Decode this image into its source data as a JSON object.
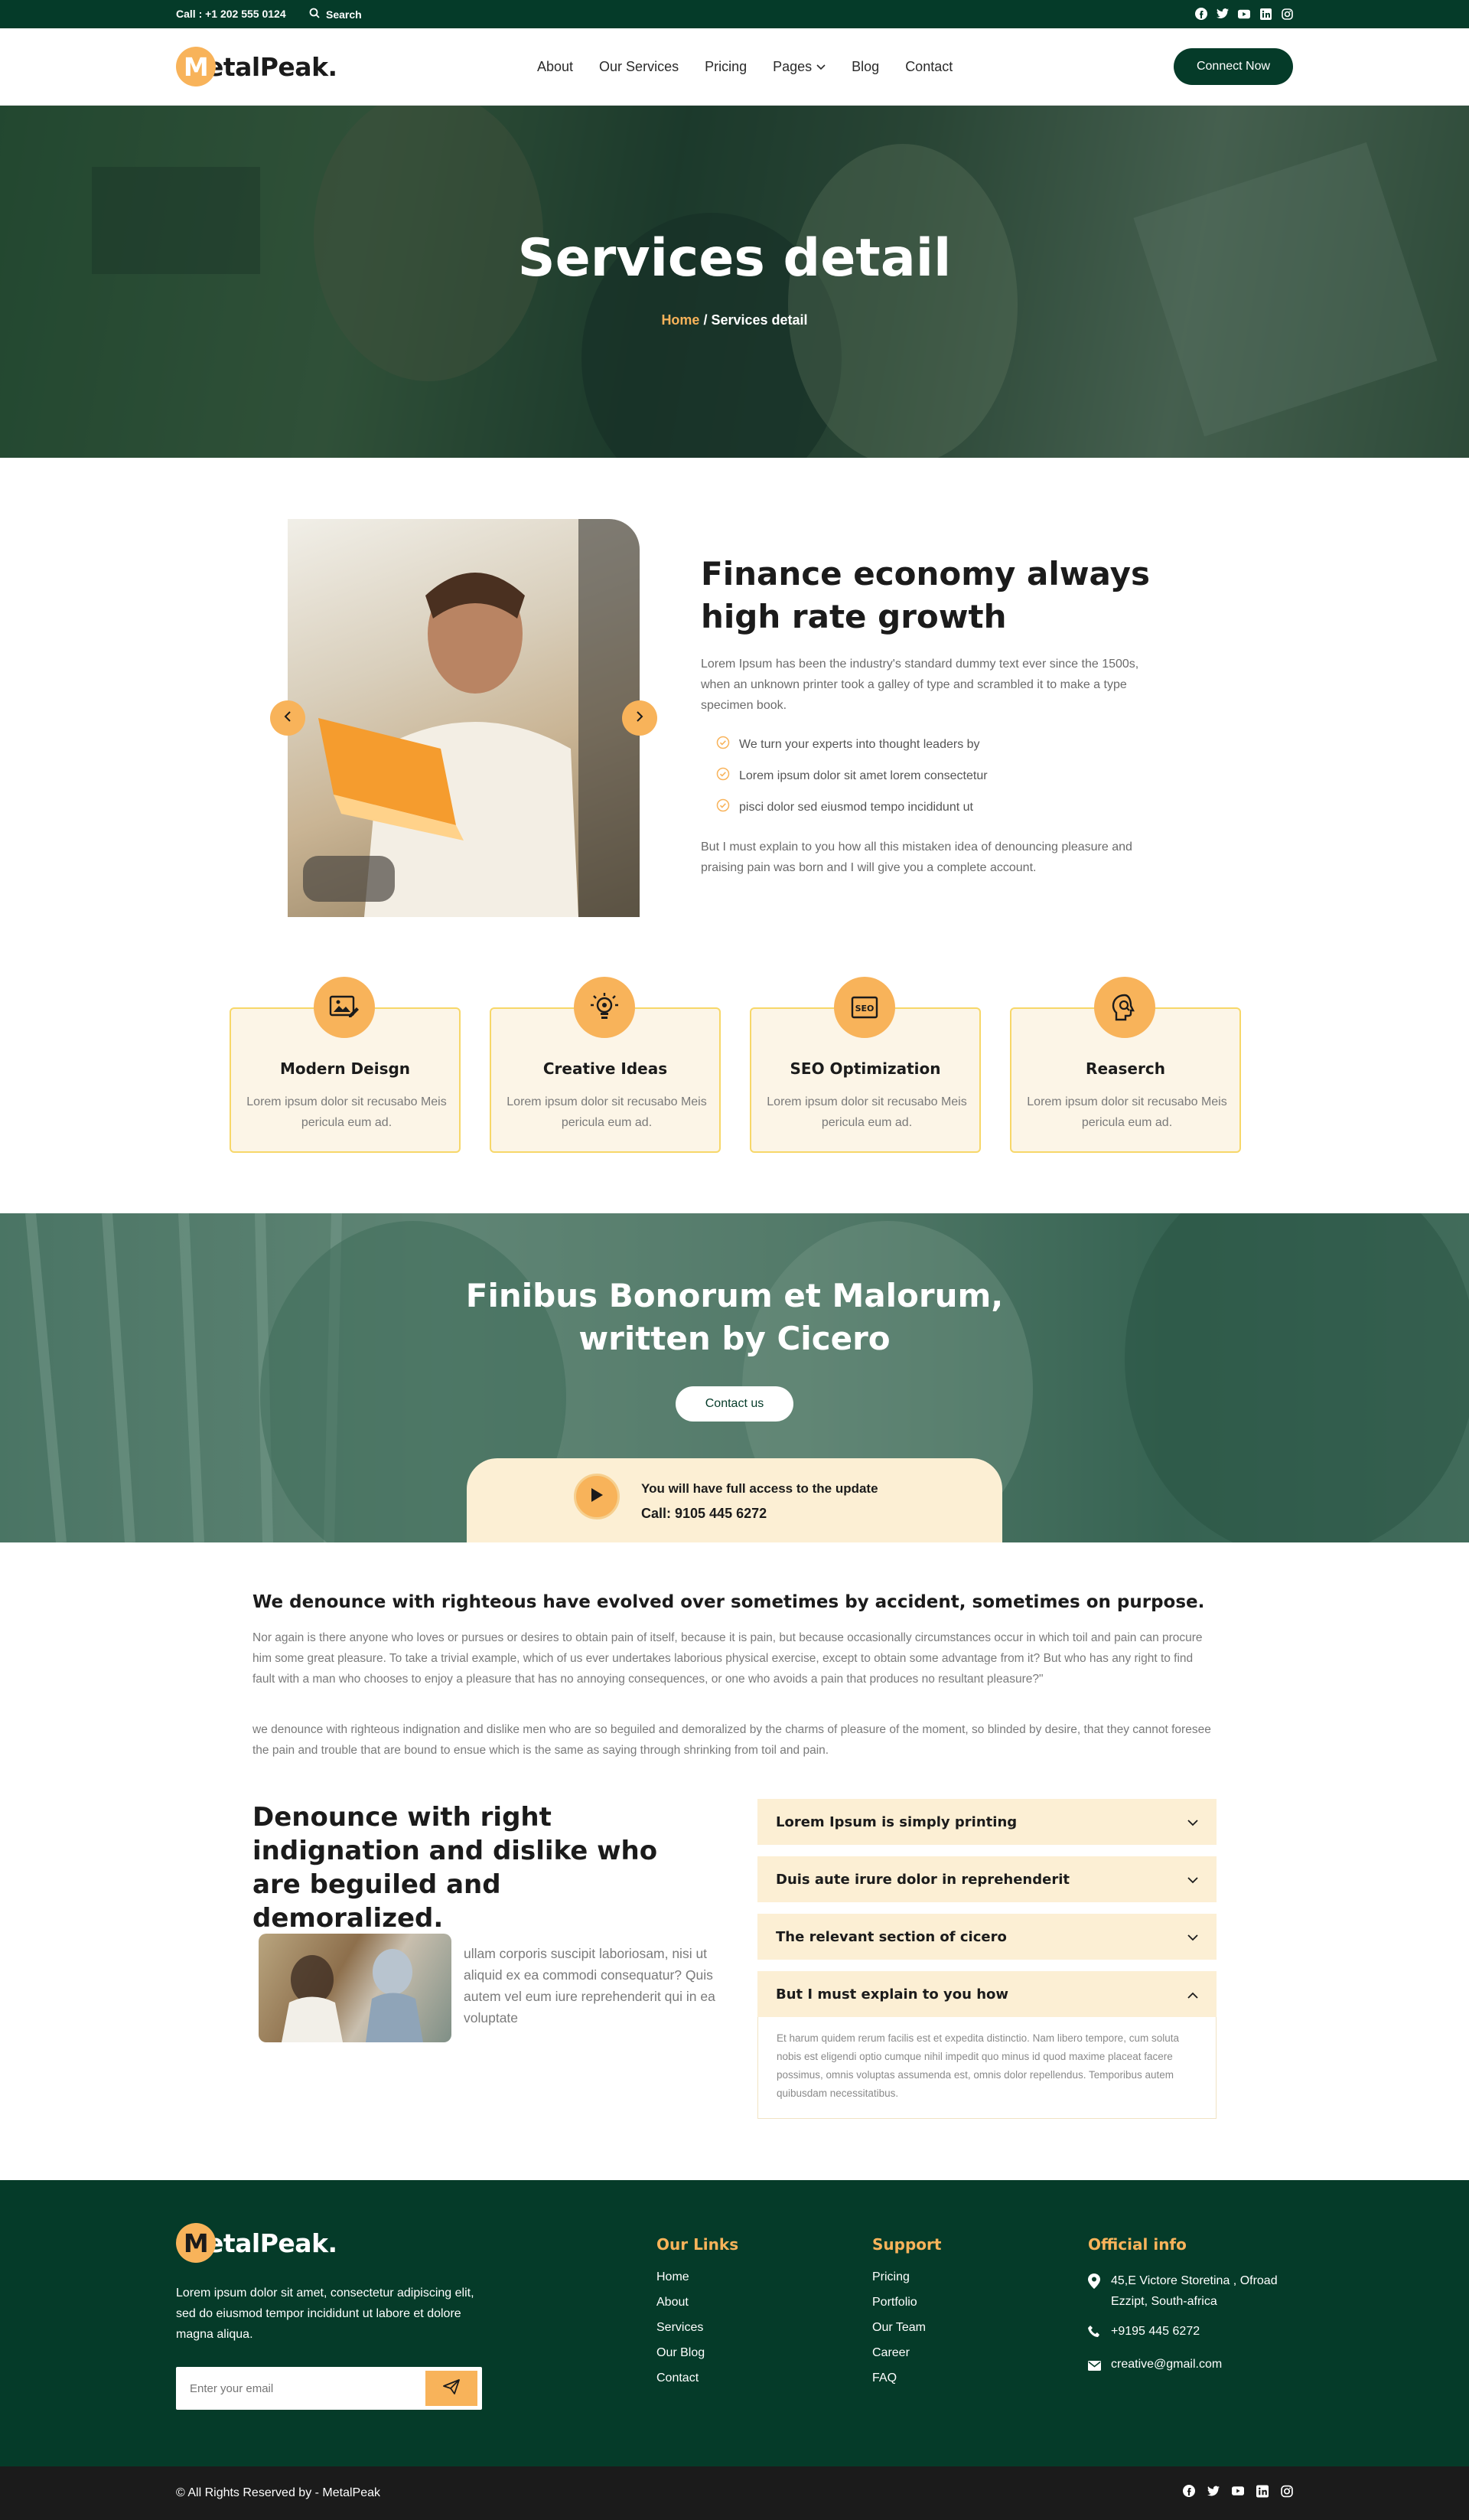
{
  "topbar": {
    "call": "Call : +1 202 555 0124",
    "search": "Search",
    "social_icons": [
      "facebook-icon",
      "twitter-icon",
      "youtube-icon",
      "linkedin-icon",
      "instagram-icon"
    ]
  },
  "brand": {
    "logo_letter": "M",
    "logo_rest": "etalPeak.",
    "accent": "#f8b35a",
    "primary": "#053b29"
  },
  "nav": {
    "items": [
      "About",
      "Our Services",
      "Pricing",
      "Pages",
      "Blog",
      "Contact"
    ],
    "cta": "Connect Now"
  },
  "hero": {
    "title": "Services detail",
    "crumb_home": "Home",
    "crumb_sep": " / ",
    "crumb_current": "Services detail"
  },
  "intro": {
    "heading": "Finance economy always high rate growth",
    "paragraph": "Lorem Ipsum has been the industry's standard dummy text ever since the 1500s, when an unknown printer took a galley of type and scrambled it to make a type specimen book.",
    "list": [
      "We turn your experts into thought leaders by",
      "Lorem ipsum dolor sit amet lorem consectetur",
      "pisci dolor sed eiusmod tempo incididunt ut"
    ],
    "paragraph2": "But I must explain to you how all this mistaken idea of denouncing pleasure and praising pain was born and I will give you a complete account."
  },
  "features": [
    {
      "title": "Modern Deisgn",
      "text": "Lorem ipsum dolor sit recusabo Meis pericula eum ad.",
      "icon": "image-edit-icon"
    },
    {
      "title": "Creative Ideas",
      "text": "Lorem ipsum dolor sit recusabo Meis pericula eum ad.",
      "icon": "bulb-icon"
    },
    {
      "title": "SEO Optimization",
      "text": "Lorem ipsum dolor sit recusabo Meis pericula eum ad.",
      "icon": "seo-icon"
    },
    {
      "title": "Reaserch",
      "text": "Lorem ipsum dolor sit recusabo Meis pericula eum ad.",
      "icon": "brain-search-icon"
    }
  ],
  "banner": {
    "line1": "Finibus Bonorum et Malorum,",
    "line2": "written by Cicero",
    "button": "Contact us",
    "strip_text": "You will have full access to the update",
    "strip_phone": "Call: 9105 445 6272"
  },
  "article": {
    "heading": "We denounce with righteous have evolved over sometimes by accident, sometimes on purpose.",
    "p1": "Nor again is there anyone who loves or pursues or desires to obtain pain of itself, because it is pain, but because occasionally circumstances occur in which toil and pain can procure him some great pleasure. To take a trivial example, which of us ever undertakes laborious physical exercise, except to obtain some advantage from it? But who has any right to find fault with a man who chooses to enjoy a pleasure that has no annoying consequences, or one who avoids a pain that produces no resultant pleasure?\"",
    "p2": "we denounce with righteous indignation and dislike men who are so beguiled and demoralized by the charms of pleasure of the moment, so blinded by desire, that they cannot foresee the pain and trouble that are bound to ensue which is the same as saying through shrinking from toil and pain."
  },
  "denounce": {
    "heading": "Denounce with right indignation and dislike who are beguiled and demoralized.",
    "text": "ullam corporis suscipit laboriosam, nisi ut aliquid ex ea commodi consequatur? Quis autem vel eum iure reprehenderit qui in ea voluptate"
  },
  "faq": {
    "items": [
      "Lorem Ipsum is simply printing",
      "Duis aute irure dolor in reprehenderit",
      "The relevant section of cicero",
      "But I must explain to you how"
    ],
    "open_index": 3,
    "open_body": "Et harum quidem rerum facilis est et expedita distinctio. Nam libero tempore, cum soluta nobis est eligendi optio cumque nihil impedit quo minus id quod maxime placeat facere possimus, omnis voluptas assumenda est, omnis dolor repellendus. Temporibus autem quibusdam necessitatibus."
  },
  "footer": {
    "about": "Lorem ipsum dolor sit amet, consectetur adipiscing elit, sed do eiusmod tempor incididunt ut labore et dolore magna aliqua.",
    "email_placeholder": "Enter your email",
    "links_title": "Our Links",
    "links": [
      "Home",
      "About",
      "Services",
      "Our Blog",
      "Contact"
    ],
    "support_title": "Support",
    "support": [
      "Pricing",
      "Portfolio",
      "Our Team",
      "Career",
      "FAQ"
    ],
    "info_title": "Official info",
    "address": "45,E Victore Storetina , Ofroad Ezzipt, South-africa",
    "phone": "+9195 445 6272",
    "email": "creative@gmail.com",
    "copyright": "© All Rights Reserved by - MetalPeak"
  }
}
